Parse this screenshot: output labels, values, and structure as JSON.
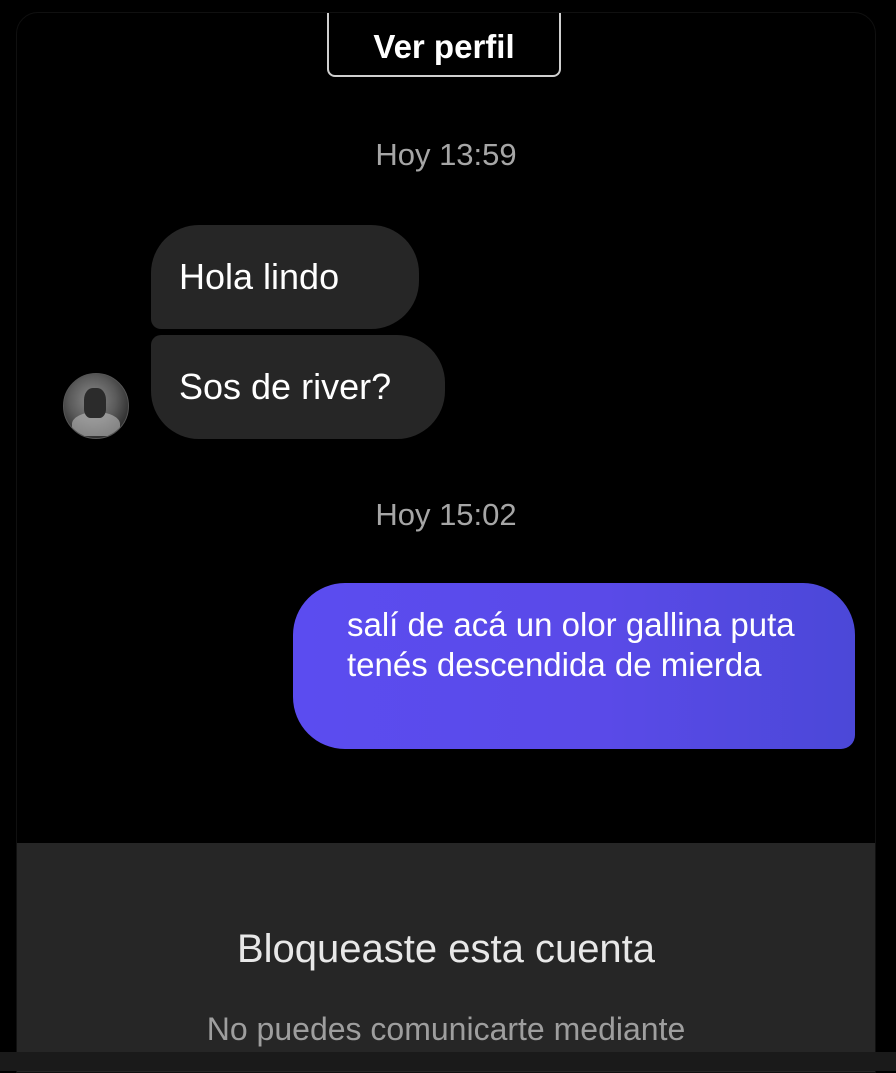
{
  "header": {
    "view_profile_label": "Ver perfil"
  },
  "conversation": {
    "timestamps": [
      "Hoy 13:59",
      "Hoy 15:02"
    ],
    "incoming": [
      {
        "text": "Hola lindo"
      },
      {
        "text": "Sos de river?"
      }
    ],
    "outgoing": [
      {
        "text": "salí de acá un olor gallina puta tenés descendida de mierda"
      }
    ],
    "avatar_icon": "user-avatar-icon"
  },
  "blocked": {
    "title": "Bloqueaste esta cuenta",
    "description": "No puedes comunicarte mediante"
  },
  "colors": {
    "background": "#000000",
    "incoming_bubble": "#262626",
    "outgoing_bubble": "#5a4ae8",
    "timestamp_text": "#a6a6a6",
    "panel": "#262626"
  }
}
